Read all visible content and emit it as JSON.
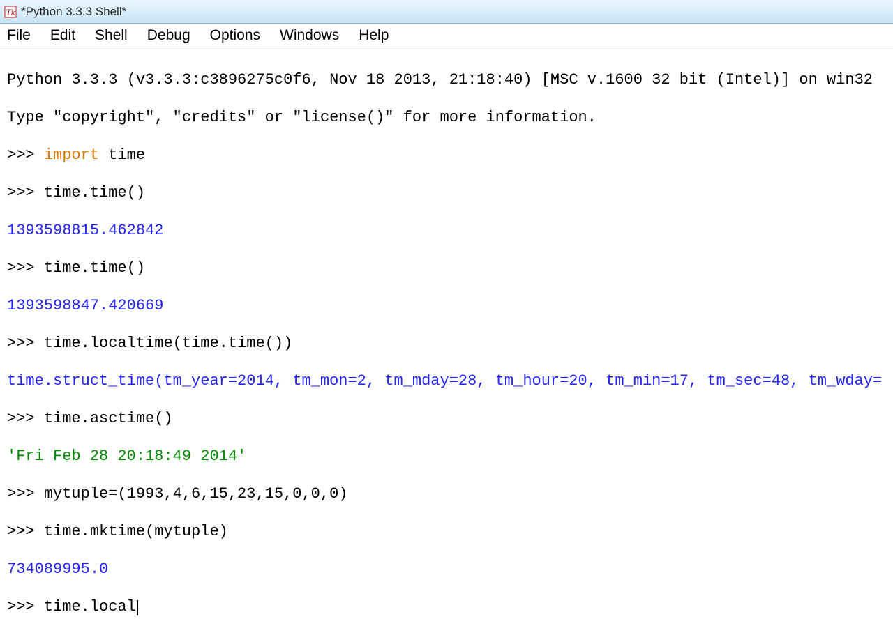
{
  "window": {
    "title": "*Python 3.3.3 Shell*"
  },
  "menubar": {
    "items": [
      "File",
      "Edit",
      "Shell",
      "Debug",
      "Options",
      "Windows",
      "Help"
    ]
  },
  "console": {
    "banner1": "Python 3.3.3 (v3.3.3:c3896275c0f6, Nov 18 2013, 21:18:40) [MSC v.1600 32 bit (Intel)] on win32",
    "banner2": "Type \"copyright\", \"credits\" or \"license()\" for more information.",
    "prompt": ">>> ",
    "lines": {
      "l1_kw": "import",
      "l1_rest": " time",
      "l2": "time.time()",
      "l3_out": "1393598815.462842",
      "l4": "time.time()",
      "l5_out": "1393598847.420669",
      "l6": "time.localtime(time.time())",
      "l7_out": "time.struct_time(tm_year=2014, tm_mon=2, tm_mday=28, tm_hour=20, tm_min=17, tm_sec=48, tm_wday=",
      "l8": "time.asctime()",
      "l9_out": "'Fri Feb 28 20:18:49 2014'",
      "l10": "mytuple=(1993,4,6,15,23,15,0,0,0)",
      "l11": "time.mktime(mytuple)",
      "l12_out": "734089995.0",
      "l13": "time.local"
    }
  }
}
